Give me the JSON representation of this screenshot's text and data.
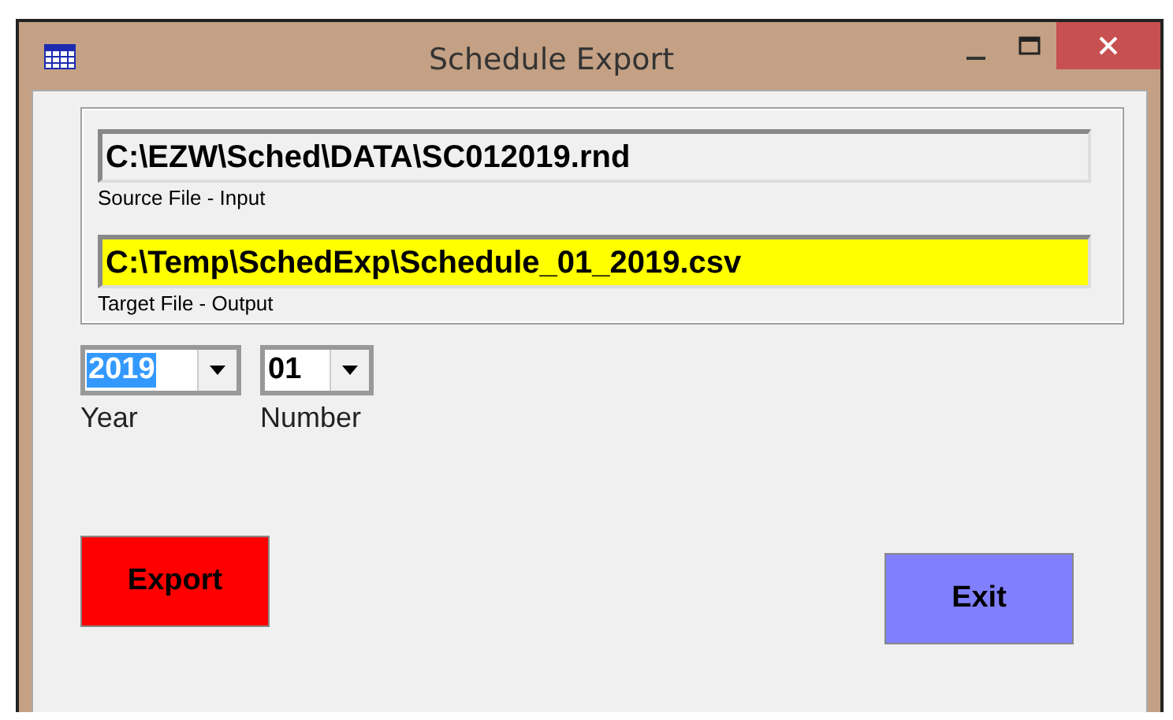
{
  "window": {
    "title": "Schedule Export"
  },
  "files": [
    {
      "value": "C:\\EZW\\Sched\\DATA\\SC012019.rnd",
      "label": "Source File - Input",
      "highlighted": false
    },
    {
      "value": "C:\\Temp\\SchedExp\\Schedule_01_2019.csv",
      "label": "Target File - Output",
      "highlighted": true
    }
  ],
  "combos": [
    {
      "value": "2019",
      "label": "Year",
      "text_selected": true
    },
    {
      "value": "01",
      "label": "Number",
      "text_selected": false
    }
  ],
  "buttons": [
    {
      "label": "Export",
      "kind": "export"
    },
    {
      "label": "Exit",
      "kind": "exit"
    }
  ]
}
